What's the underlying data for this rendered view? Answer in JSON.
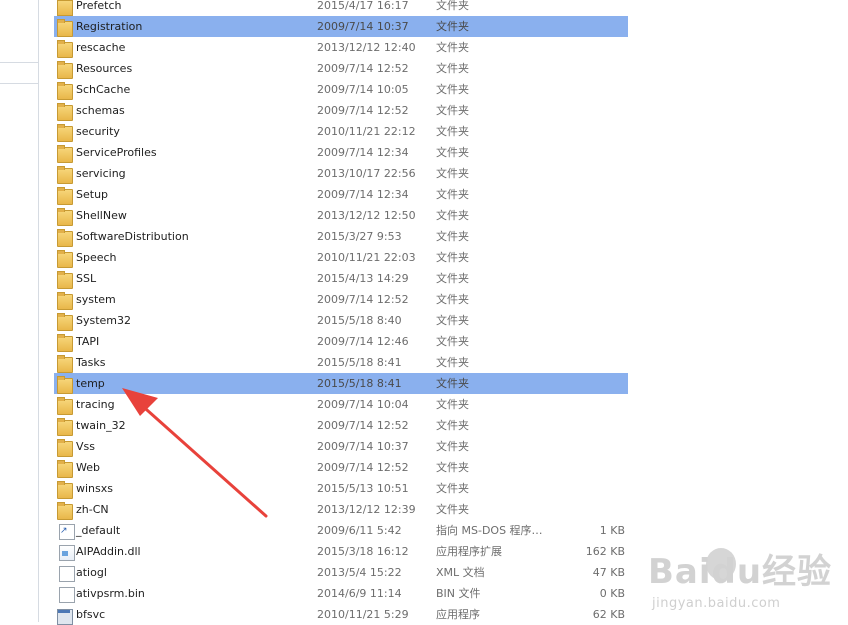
{
  "files": [
    {
      "name": "Prefetch",
      "date": "2015/4/17 16:17",
      "type": "文件夹",
      "size": "",
      "icon": "lock-folder-icon",
      "selected": false
    },
    {
      "name": "Registration",
      "date": "2009/7/14 10:37",
      "type": "文件夹",
      "size": "",
      "icon": "folder-icon",
      "selected": true
    },
    {
      "name": "rescache",
      "date": "2013/12/12 12:40",
      "type": "文件夹",
      "size": "",
      "icon": "folder-icon",
      "selected": false
    },
    {
      "name": "Resources",
      "date": "2009/7/14 12:52",
      "type": "文件夹",
      "size": "",
      "icon": "folder-icon",
      "selected": false
    },
    {
      "name": "SchCache",
      "date": "2009/7/14 10:05",
      "type": "文件夹",
      "size": "",
      "icon": "folder-icon",
      "selected": false
    },
    {
      "name": "schemas",
      "date": "2009/7/14 12:52",
      "type": "文件夹",
      "size": "",
      "icon": "folder-icon",
      "selected": false
    },
    {
      "name": "security",
      "date": "2010/11/21 22:12",
      "type": "文件夹",
      "size": "",
      "icon": "folder-icon",
      "selected": false
    },
    {
      "name": "ServiceProfiles",
      "date": "2009/7/14 12:34",
      "type": "文件夹",
      "size": "",
      "icon": "folder-icon",
      "selected": false
    },
    {
      "name": "servicing",
      "date": "2013/10/17 22:56",
      "type": "文件夹",
      "size": "",
      "icon": "folder-icon",
      "selected": false
    },
    {
      "name": "Setup",
      "date": "2009/7/14 12:34",
      "type": "文件夹",
      "size": "",
      "icon": "folder-icon",
      "selected": false
    },
    {
      "name": "ShellNew",
      "date": "2013/12/12 12:50",
      "type": "文件夹",
      "size": "",
      "icon": "folder-icon",
      "selected": false
    },
    {
      "name": "SoftwareDistribution",
      "date": "2015/3/27 9:53",
      "type": "文件夹",
      "size": "",
      "icon": "folder-icon",
      "selected": false
    },
    {
      "name": "Speech",
      "date": "2010/11/21 22:03",
      "type": "文件夹",
      "size": "",
      "icon": "folder-icon",
      "selected": false
    },
    {
      "name": "SSL",
      "date": "2015/4/13 14:29",
      "type": "文件夹",
      "size": "",
      "icon": "folder-icon",
      "selected": false
    },
    {
      "name": "system",
      "date": "2009/7/14 12:52",
      "type": "文件夹",
      "size": "",
      "icon": "folder-icon",
      "selected": false
    },
    {
      "name": "System32",
      "date": "2015/5/18 8:40",
      "type": "文件夹",
      "size": "",
      "icon": "folder-icon",
      "selected": false
    },
    {
      "name": "TAPI",
      "date": "2009/7/14 12:46",
      "type": "文件夹",
      "size": "",
      "icon": "folder-icon",
      "selected": false
    },
    {
      "name": "Tasks",
      "date": "2015/5/18 8:41",
      "type": "文件夹",
      "size": "",
      "icon": "folder-icon",
      "selected": false
    },
    {
      "name": "temp",
      "date": "2015/5/18 8:41",
      "type": "文件夹",
      "size": "",
      "icon": "folder-icon",
      "selected": true
    },
    {
      "name": "tracing",
      "date": "2009/7/14 10:04",
      "type": "文件夹",
      "size": "",
      "icon": "folder-icon",
      "selected": false
    },
    {
      "name": "twain_32",
      "date": "2009/7/14 12:52",
      "type": "文件夹",
      "size": "",
      "icon": "folder-icon",
      "selected": false
    },
    {
      "name": "Vss",
      "date": "2009/7/14 10:37",
      "type": "文件夹",
      "size": "",
      "icon": "folder-icon",
      "selected": false
    },
    {
      "name": "Web",
      "date": "2009/7/14 12:52",
      "type": "文件夹",
      "size": "",
      "icon": "folder-icon",
      "selected": false
    },
    {
      "name": "winsxs",
      "date": "2015/5/13 10:51",
      "type": "文件夹",
      "size": "",
      "icon": "folder-icon",
      "selected": false
    },
    {
      "name": "zh-CN",
      "date": "2013/12/12 12:39",
      "type": "文件夹",
      "size": "",
      "icon": "folder-icon",
      "selected": false
    },
    {
      "name": "_default",
      "date": "2009/6/11 5:42",
      "type": "指向 MS-DOS 程序…",
      "size": "1 KB",
      "icon": "shortcut-file-icon",
      "selected": false
    },
    {
      "name": "AIPAddin.dll",
      "date": "2015/3/18 16:12",
      "type": "应用程序扩展",
      "size": "162 KB",
      "icon": "dll-file-icon",
      "selected": false
    },
    {
      "name": "atiogl",
      "date": "2013/5/4 15:22",
      "type": "XML 文档",
      "size": "47 KB",
      "icon": "xml-file-icon",
      "selected": false
    },
    {
      "name": "ativpsrm.bin",
      "date": "2014/6/9 11:14",
      "type": "BIN 文件",
      "size": "0 KB",
      "icon": "bin-file-icon",
      "selected": false
    },
    {
      "name": "bfsvc",
      "date": "2010/11/21 5:29",
      "type": "应用程序",
      "size": "62 KB",
      "icon": "application-icon",
      "selected": false
    }
  ],
  "colors": {
    "selected_row": "#8ab0ee",
    "arrow": "#e8423b"
  },
  "watermark": {
    "logo": "Baidu经验",
    "url": "jingyan.baidu.com"
  }
}
